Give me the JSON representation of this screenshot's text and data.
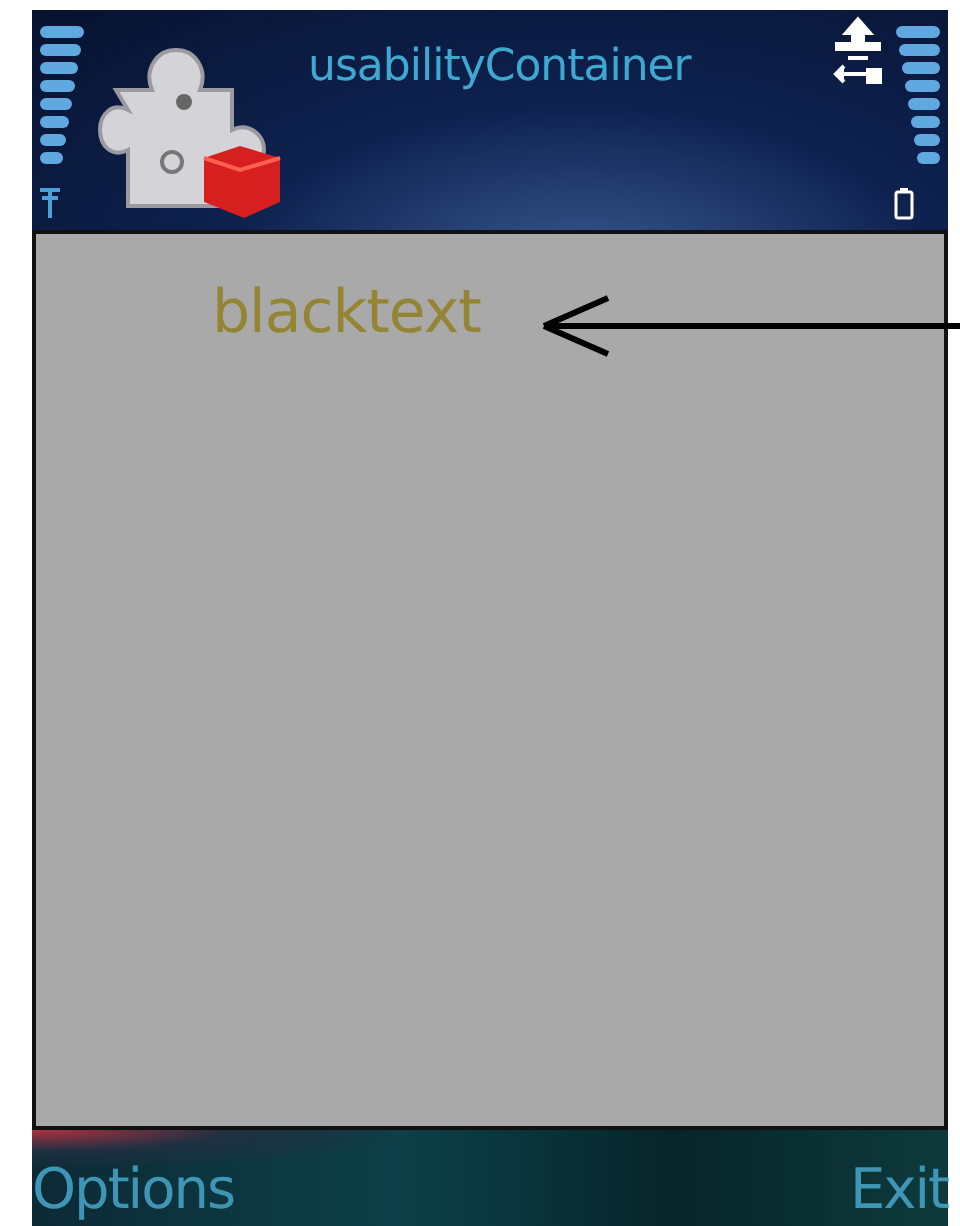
{
  "status_bar": {
    "title": "usabilityContainer"
  },
  "content": {
    "label": "blacktext",
    "annotation": {
      "kind": "arrow"
    }
  },
  "softkeys": {
    "left": "Options",
    "right": "Exit"
  }
}
